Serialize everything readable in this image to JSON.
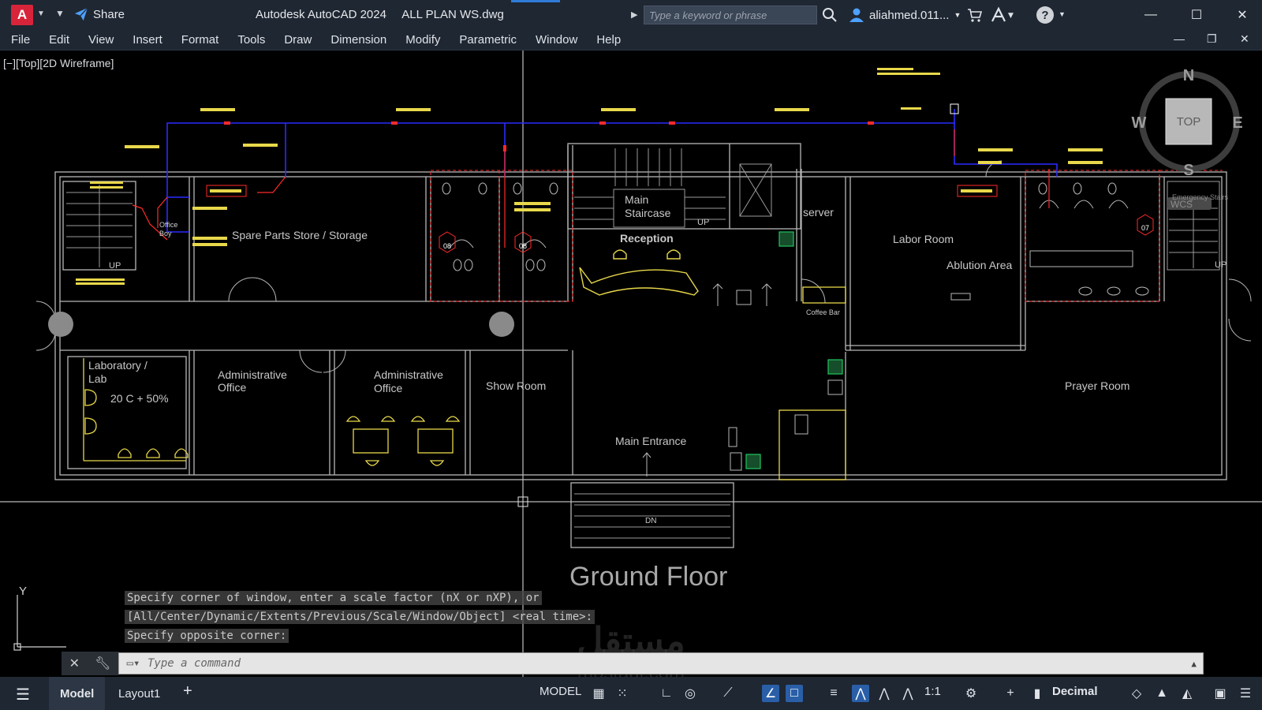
{
  "titlebar": {
    "logo": "A",
    "share": "Share",
    "app_name": "Autodesk AutoCAD 2024",
    "file_name": "ALL PLAN WS.dwg",
    "search_placeholder": "Type a keyword or phrase",
    "user": "aliahmed.011...",
    "help": "?"
  },
  "menu": [
    "File",
    "Edit",
    "View",
    "Insert",
    "Format",
    "Tools",
    "Draw",
    "Dimension",
    "Modify",
    "Parametric",
    "Window",
    "Help"
  ],
  "viewport": {
    "label": "[−][Top][2D Wireframe]",
    "compass": {
      "n": "N",
      "s": "S",
      "e": "E",
      "w": "W",
      "top": "TOP",
      "wcs": "WCS"
    },
    "ucs_y": "Y",
    "rooms": {
      "spare_parts": "Spare Parts Store / Storage",
      "office": "Office",
      "boy": "Boy",
      "lab_1": "Laboratory /",
      "lab_2": "Lab",
      "lab_note": "20 C + 50%",
      "admin1_1": "Administrative",
      "admin1_2": "Office",
      "admin2_1": "Administrative",
      "admin2_2": "Office",
      "show_room": "Show Room",
      "main_stair_1": "Main",
      "main_stair_2": "Staircase",
      "reception": "Reception",
      "server": "server",
      "coffee_bar": "Coffee Bar",
      "main_entrance": "Main Entrance",
      "labor_room": "Labor Room",
      "ablution": "Ablution Area",
      "prayer_room": "Prayer Room",
      "emergency": "Emergency Stairs",
      "up1": "UP",
      "up2": "UP",
      "up3": "UP",
      "dn": "DN",
      "wc_08a": "08",
      "wc_08b": "08",
      "wc_07": "07",
      "ground_floor": "Ground Floor"
    }
  },
  "command": {
    "history": [
      "Specify corner of window, enter a scale factor (nX or nXP), or",
      "[All/Center/Dynamic/Extents/Previous/Scale/Window/Object] <real time>:",
      "Specify opposite corner:"
    ],
    "placeholder": "Type a command"
  },
  "statusbar": {
    "model_tab": "Model",
    "layout_tab": "Layout1",
    "model_space": "MODEL",
    "scale": "1:1",
    "units": "Decimal"
  },
  "watermark": {
    "arabic": "مستقل",
    "latin": "mostaql.com"
  },
  "colors": {
    "yellow": "#e8d84a",
    "blue": "#2b2bff",
    "red": "#ff2a2a",
    "wall": "#b7b7b7",
    "green": "#22c55e",
    "chrome": "#1f2733"
  }
}
